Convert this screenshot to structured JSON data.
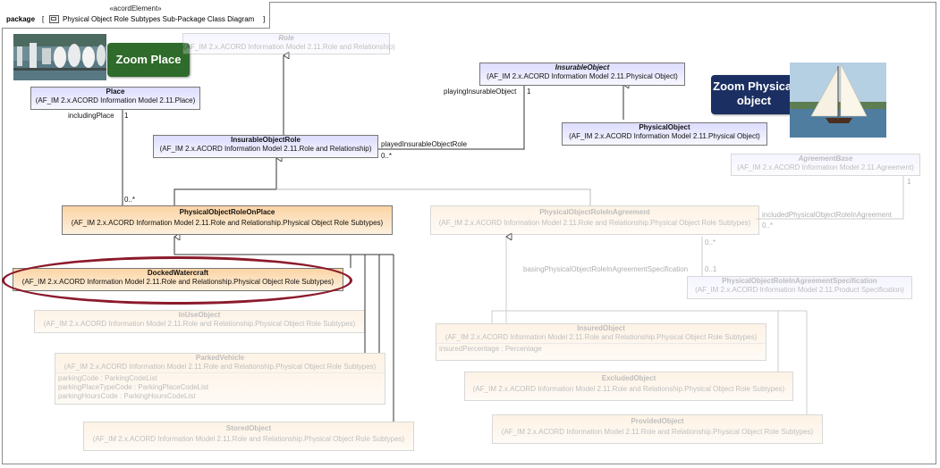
{
  "diagram": {
    "stereotype": "«acordElement»",
    "keyword": "package",
    "title": "Physical Object Role Subtypes Sub-Package Class Diagram"
  },
  "zoom": {
    "place_label": "Zoom Place",
    "physical_label_line1": "Zoom Physical",
    "physical_label_line2": "object",
    "place_color": "#2f6b2a",
    "physical_color": "#1c2f63"
  },
  "classes": {
    "role": {
      "name": "Role",
      "pkg": "(AF_IM 2.x.ACORD Information Model 2.11.Role and Relationship)"
    },
    "place": {
      "name": "Place",
      "pkg": "(AF_IM 2.x.ACORD Information Model 2.11.Place)"
    },
    "insurable_object": {
      "name": "InsurableObject",
      "pkg": "(AF_IM 2.x.ACORD Information Model 2.11.Physical Object)"
    },
    "physical_object": {
      "name": "PhysicalObject",
      "pkg": "(AF_IM 2.x.ACORD Information Model 2.11.Physical Object)"
    },
    "insurable_object_role": {
      "name": "InsurableObjectRole",
      "pkg": "(AF_IM 2.x.ACORD Information Model 2.11.Role and Relationship)"
    },
    "agreement_base": {
      "name": "AgreementBase",
      "pkg": "(AF_IM 2.x.ACORD Information Model 2.11.Agreement)"
    },
    "phys_role_on_place": {
      "name": "PhysicalObjectRoleOnPlace",
      "pkg": "(AF_IM 2.x.ACORD Information Model 2.11.Role and Relationship.Physical Object Role Subtypes)"
    },
    "phys_role_in_agreement": {
      "name": "PhysicalObjectRoleInAgreement",
      "pkg": "(AF_IM 2.x.ACORD Information Model 2.11.Role and Relationship.Physical Object Role Subtypes)"
    },
    "docked_watercraft": {
      "name": "DockedWatercraft",
      "pkg": "(AF_IM 2.x.ACORD Information Model 2.11.Role and Relationship.Physical Object Role Subtypes)"
    },
    "phys_role_in_agreement_spec": {
      "name": "PhysicalObjectRoleInAgreementSpecification",
      "pkg": "(AF_IM 2.x.ACORD Information Model 2.11.Product Specification)"
    },
    "in_use_object": {
      "name": "InUseObject",
      "pkg": "(AF_IM 2.x.ACORD Information Model 2.11.Role and Relationship.Physical Object Role Subtypes)"
    },
    "insured_object": {
      "name": "InsuredObject",
      "pkg": "(AF_IM 2.x.ACORD Information Model 2.11.Role and Relationship.Physical Object Role Subtypes)",
      "attrs": [
        "insuredPercentage : Percentage"
      ]
    },
    "parked_vehicle": {
      "name": "ParkedVehicle",
      "pkg": "(AF_IM 2.x.ACORD Information Model 2.11.Role and Relationship.Physical Object Role Subtypes)",
      "attrs": [
        "parkingCode : ParkingCodeList",
        "parkingPlaceTypeCode : ParkingPlaceCodeList",
        "parkingHoursCode : ParkingHoursCodeList"
      ]
    },
    "excluded_object": {
      "name": "ExcludedObject",
      "pkg": "(AF_IM 2.x.ACORD Information Model 2.11.Role and Relationship.Physical Object Role Subtypes)"
    },
    "provided_object": {
      "name": "ProvidedObject",
      "pkg": "(AF_IM 2.x.ACORD Information Model 2.11.Role and Relationship.Physical Object Role Subtypes)"
    },
    "stored_object": {
      "name": "StoredObject",
      "pkg": "(AF_IM 2.x.ACORD Information Model 2.11.Role and Relationship.Physical Object Role Subtypes)"
    }
  },
  "labels": {
    "including_place": "includingPlace",
    "including_place_mult": "1",
    "role_on_place_mult": "0..*",
    "playing_insurable_object": "playingInsurableObject",
    "playing_mult": "1",
    "played_insurable_object_role": "playedInsurableObjectRole",
    "played_mult": "0..*",
    "included_phys_role_in_agreement": "includedPhysicalObjectRoleInAgreement",
    "included_mult": "0..*",
    "agreement_base_mult": "1",
    "basing_spec": "basingPhysicalObjectRoleInAgreementSpecification",
    "basing_mult_a": "0..*",
    "basing_mult_b": "0..1"
  }
}
